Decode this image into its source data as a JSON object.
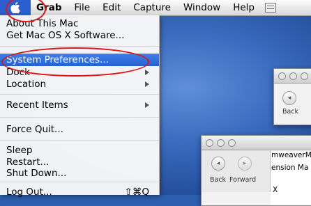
{
  "menubar": {
    "app_name": "Grab",
    "menus": [
      "File",
      "Edit",
      "Capture",
      "Window",
      "Help"
    ]
  },
  "apple_menu": {
    "about": "About This Mac",
    "software": "Get Mac OS X Software...",
    "system_prefs": "System Preferences...",
    "dock": "Dock",
    "location": "Location",
    "recent_items": "Recent Items",
    "force_quit": "Force Quit...",
    "sleep": "Sleep",
    "restart": "Restart...",
    "shut_down": "Shut Down...",
    "log_out": "Log Out...",
    "log_out_shortcut": "⇧⌘Q",
    "highlighted_item": "System Preferences..."
  },
  "window_back": {
    "back_label": "Back"
  },
  "window_front": {
    "back_label": "Back",
    "forward_label": "Forward",
    "text_line1": "mweaverM",
    "text_line2": "ension Ma",
    "text_line3": "X"
  },
  "colors": {
    "highlight": "#2662d4",
    "annotation_ring": "#e01414",
    "desktop": "#3b6cc0"
  }
}
